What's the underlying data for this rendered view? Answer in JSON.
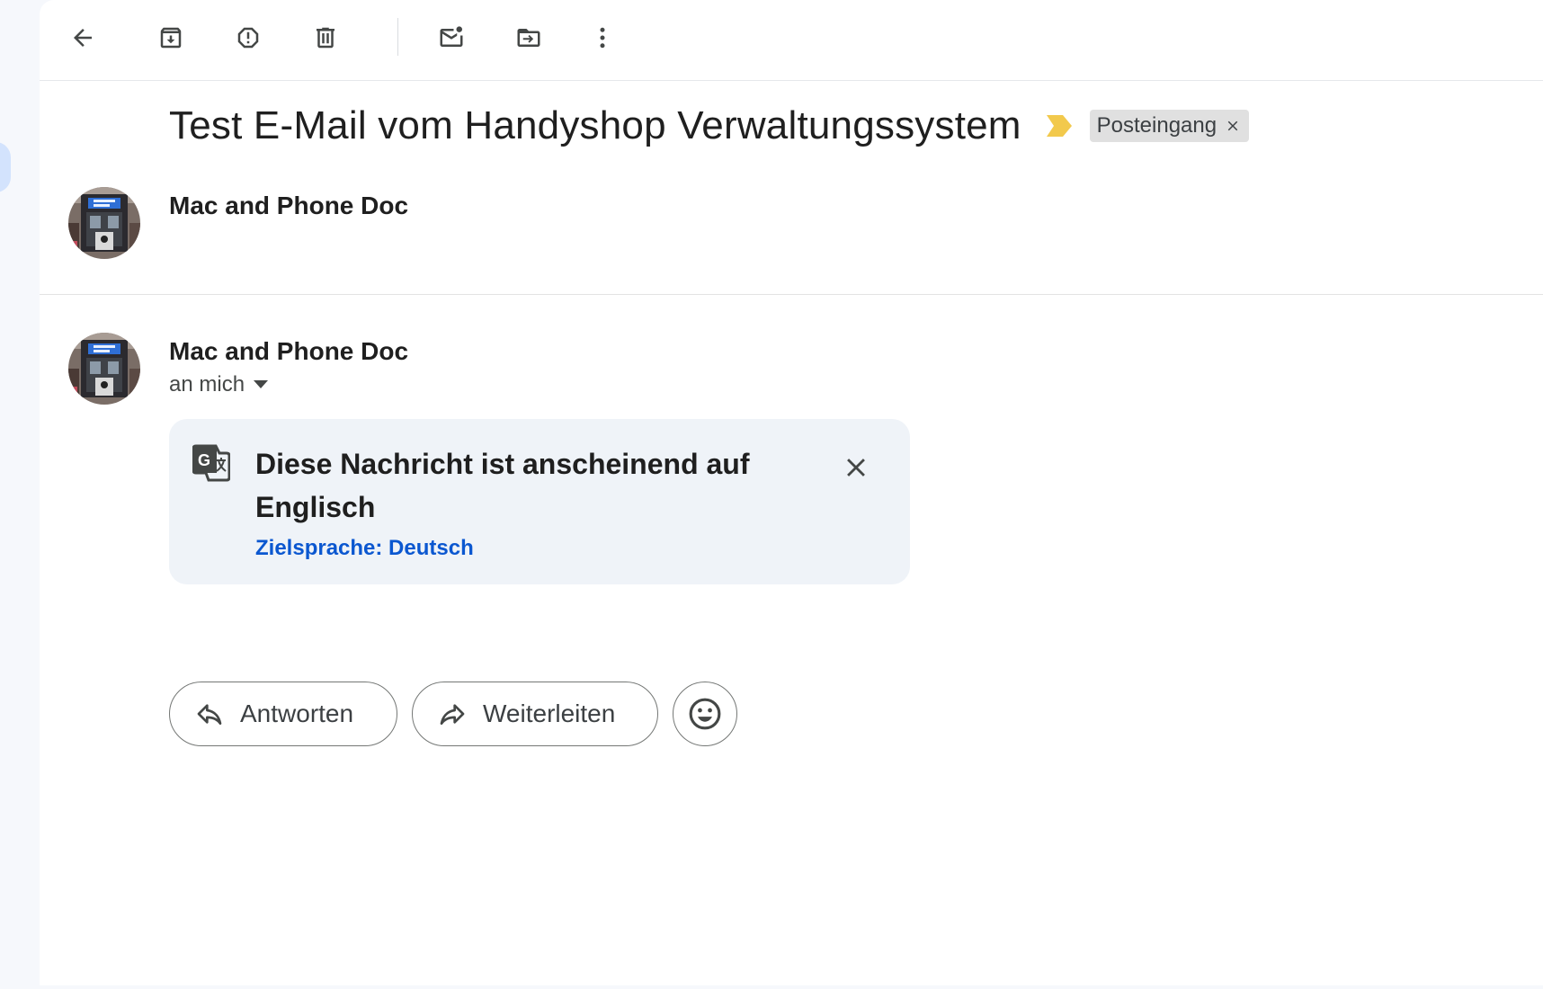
{
  "toolbar": {
    "icons": [
      "arrow-back-icon",
      "archive-icon",
      "report-spam-icon",
      "delete-icon",
      "mark-unread-icon",
      "move-to-icon",
      "more-vert-icon"
    ]
  },
  "thread": {
    "subject": "Test E-Mail vom Handyshop Verwaltungssystem",
    "importance_color": "#f2c94c",
    "label": "Posteingang",
    "label_remove": "×"
  },
  "messages": [
    {
      "sender": "Mac and Phone Doc",
      "collapsed": true
    },
    {
      "sender": "Mac and Phone Doc",
      "recipient": "an mich",
      "collapsed": false
    }
  ],
  "translate_banner": {
    "title": "Diese Nachricht ist anscheinend auf Englisch",
    "target_language": "Zielsprache: Deutsch",
    "link_color": "#0b57d0"
  },
  "actions": {
    "reply": "Antworten",
    "forward": "Weiterleiten",
    "emoji_icon": "smiley-icon"
  }
}
